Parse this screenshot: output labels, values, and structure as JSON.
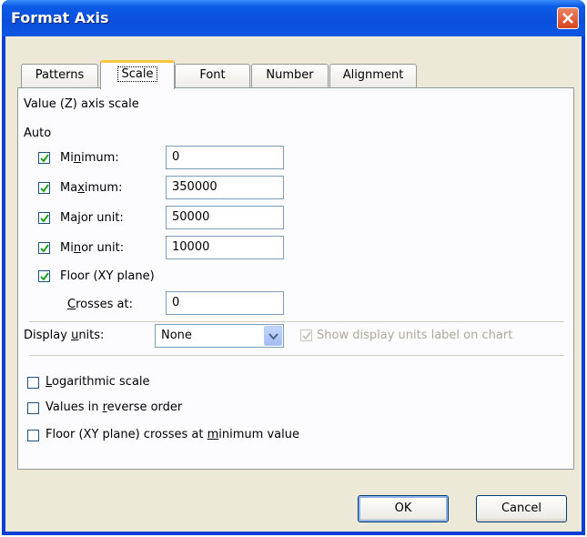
{
  "window": {
    "title": "Format Axis"
  },
  "tabs": [
    {
      "label": "Patterns"
    },
    {
      "label": "Scale"
    },
    {
      "label": "Font"
    },
    {
      "label": "Number"
    },
    {
      "label": "Alignment"
    }
  ],
  "scale": {
    "heading": "Value (Z) axis scale",
    "auto_label": "Auto",
    "minimum": {
      "label_pre": "Mi",
      "label_key": "n",
      "label_post": "imum:",
      "checked": true,
      "value": "0"
    },
    "maximum": {
      "label_pre": "Ma",
      "label_key": "x",
      "label_post": "imum:",
      "checked": true,
      "value": "350000"
    },
    "major": {
      "label_pre": "Ma",
      "label_key": "j",
      "label_post": "or unit:",
      "checked": true,
      "value": "50000"
    },
    "minor": {
      "label_pre": "Mi",
      "label_key": "n",
      "label_post": "or unit:",
      "checked": true,
      "value": "10000"
    },
    "floor": {
      "label": "Floor (XY plane)",
      "checked": true
    },
    "crosses": {
      "label_key": "C",
      "label_post": "rosses at:",
      "value": "0"
    },
    "display_units": {
      "label_pre": "Display ",
      "label_key": "u",
      "label_post": "nits:",
      "selected": "None"
    },
    "show_units_label": {
      "label": "Show display units label on chart",
      "checked": true,
      "disabled": true
    },
    "logarithmic": {
      "label_key": "L",
      "label_post": "ogarithmic scale",
      "checked": false
    },
    "reverse": {
      "label_pre": "Values in ",
      "label_key": "r",
      "label_post": "everse order",
      "checked": false
    },
    "floor_min": {
      "label_pre": "Floor (XY plane) crosses at ",
      "label_key": "m",
      "label_post": "inimum value",
      "checked": false
    }
  },
  "buttons": {
    "ok": "OK",
    "cancel": "Cancel"
  },
  "colors": {
    "titlebar": "#0a4fdc",
    "dialog_bg": "#ece9d8",
    "checkmark": "#21a121",
    "close": "#d6451d"
  }
}
